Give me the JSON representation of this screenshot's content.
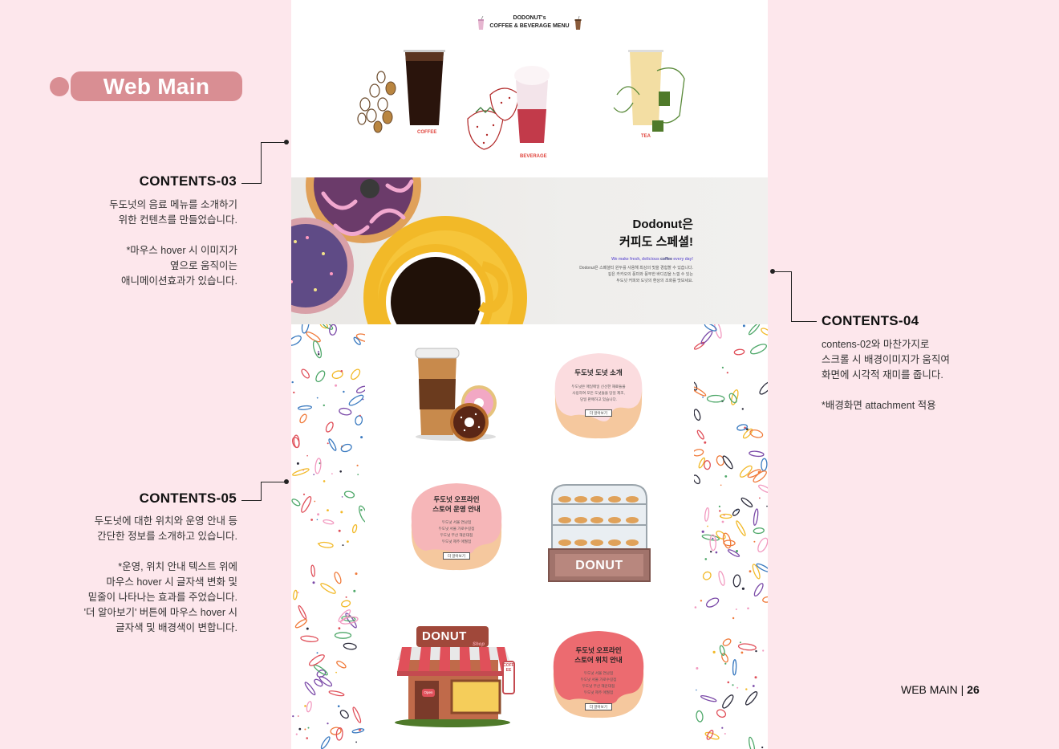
{
  "page_label": "Web Main",
  "contents_03": {
    "title": "CONTENTS-03",
    "body": "두도넛의 음료 메뉴를 소개하기\n위한 컨텐츠를 만들었습니다.\n\n*마우스 hover 시 이미지가\n옆으로 움직이는\n애니메이션효과가 있습니다."
  },
  "contents_04": {
    "title": "CONTENTS-04",
    "body": "contens-02와 마찬가지로\n스크롤 시 배경이미지가 움직여\n화면에 시각적 재미를 줍니다.\n\n*배경화면 attachment 적용"
  },
  "contents_05": {
    "title": "CONTENTS-05",
    "body": "두도넛에 대한 위치와 운영 안내 등\n간단한 정보를 소개하고 있습니다.\n\n*운영, 위치 안내 텍스트 위에\n마우스 hover 시 글자색 변화 및\n밑줄이 나타나는 효과를 주었습니다.\n'더 알아보기' 버튼에 마우스 hover 시\n글자색 및 배경색이 변합니다."
  },
  "footer": {
    "section": "WEB MAIN",
    "separator": "|",
    "page": "26"
  },
  "menu": {
    "head_line1": "DODONUT's",
    "head_line2": "COFFEE & BEVERAGE  MENU",
    "items": [
      {
        "label": "COFFEE"
      },
      {
        "label": "BEVERAGE"
      },
      {
        "label": "TEA"
      }
    ]
  },
  "hero": {
    "title_line1": "Dodonut은",
    "title_line2": "커피도 스페셜!",
    "sub_pre": "We make fresh, delicious ",
    "sub_bold": "coffee",
    "sub_post": " every day!",
    "body": "Dodonut은 스페셜티 원두를 사용해 최상의 맛을 경험할 수 있습니다.\n깊은 카카오의 풍미와 풍부한 바디감을 느낄 수 있는\n두도넛 커피와 도넛의 환상의 조화를 맛보세요."
  },
  "store": {
    "intro": {
      "title": "두도넛 도넛 소개",
      "text": "두도넛은 매일매일 신선한 재료들을\n사용하여 모든 도넛들을 당일 제조,\n당일 판매하고 있습니다.",
      "button": "더 알아보기"
    },
    "hours": {
      "title": "두도넛 오프라인\n스토어 운영 안내",
      "text": "두도넛 서울 연남점\n두도넛 서울 가로수길점\n두도넛 부산 해운대점\n두도넛 제주 애월점",
      "button": "더 알아보기"
    },
    "location": {
      "title": "두도넛 오프라인\n스토어 위치 안내",
      "text": "두도넛 서울 연남점\n두도넛 서울 가로수길점\n두도넛 부산 해운대점\n두도넛 제주 애월점",
      "button": "더 알아보기"
    },
    "case_sign": "DONUT",
    "shop_sign": "DONUT",
    "shop_script": "Shop",
    "open_sign": "Open",
    "vertical_sign": "COFFEE"
  },
  "colors": {
    "page_bg": "#fde7ec",
    "pill": "#d98e93",
    "blob_pink_light": "#fbdcdf",
    "blob_pink": "#f6b6b8",
    "blob_red": "#ec6b70",
    "blob_base": "#f5c89e"
  }
}
